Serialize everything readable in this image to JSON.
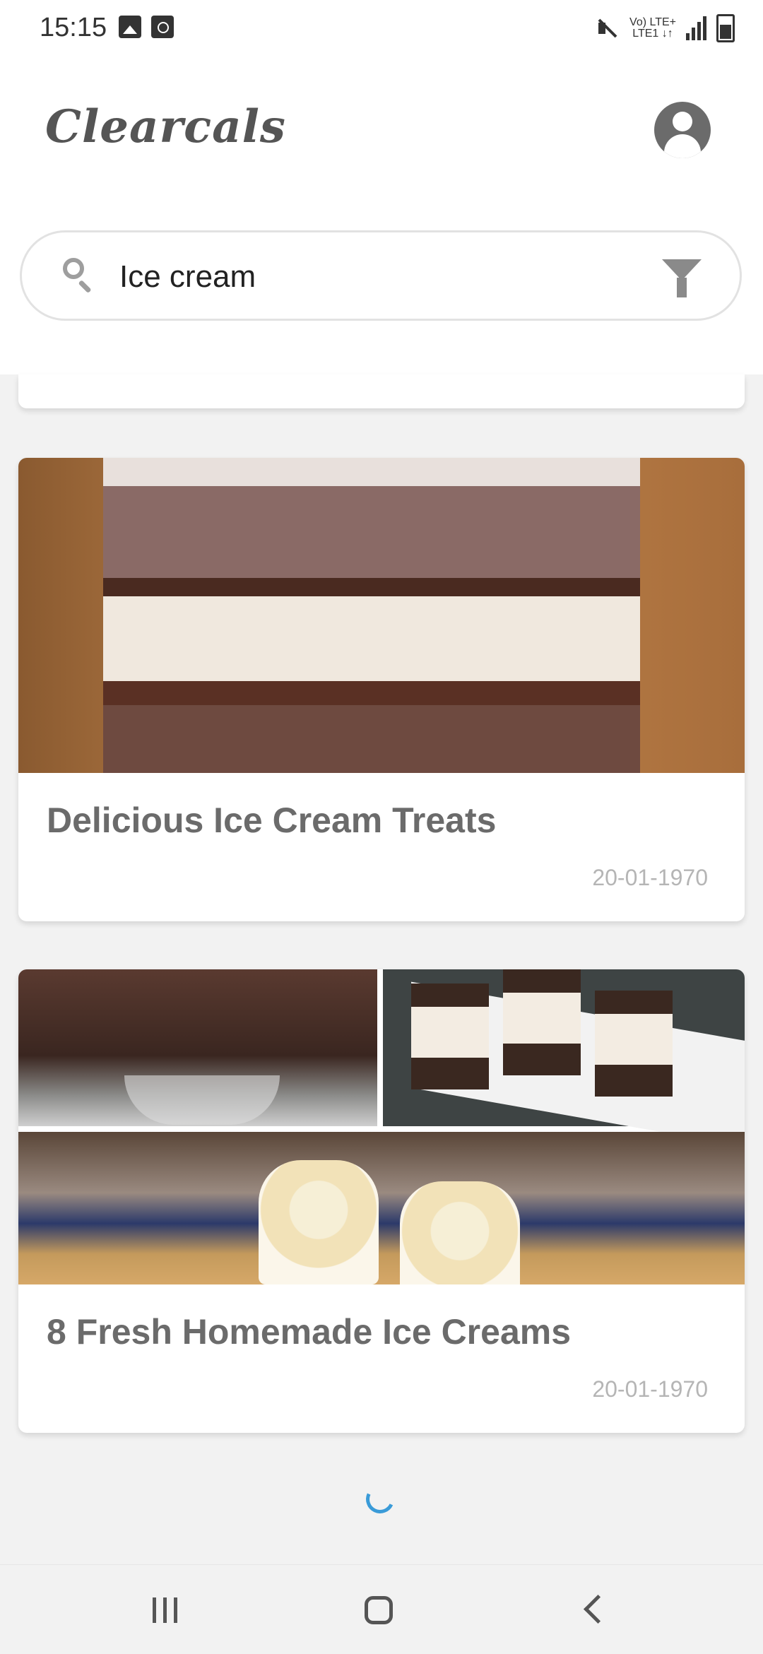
{
  "status_bar": {
    "time": "15:15",
    "network_label": "Vo) LTE+\nLTE1 ↓↑"
  },
  "header": {
    "app_title": "Clearcals",
    "profile_icon": "account-circle-icon"
  },
  "search": {
    "value": "Ice cream",
    "icons": {
      "search": "search-icon",
      "filter": "filter-icon"
    }
  },
  "recipes": [
    {
      "title": "Delicious Ice Cream Treats",
      "date": "20-01-1970"
    },
    {
      "title": "8 Fresh Homemade Ice Creams",
      "date": "20-01-1970"
    }
  ],
  "loading": true,
  "colors": {
    "accent": "#3a9bd8",
    "title_text": "#6b6b6b",
    "date_text": "#b5b5b5",
    "background": "#f2f2f2"
  },
  "nav": {
    "recent_icon": "recent-apps-icon",
    "home_icon": "home-icon",
    "back_icon": "back-icon"
  }
}
